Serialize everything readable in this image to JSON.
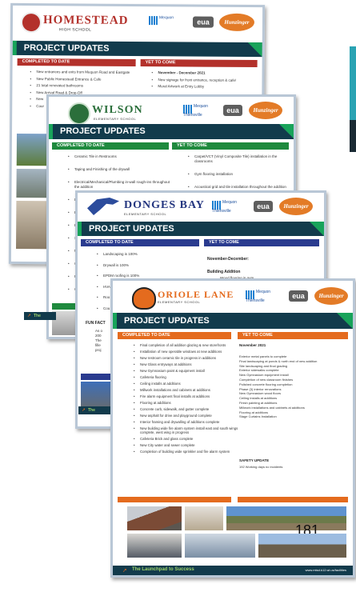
{
  "card1": {
    "school": "HOMESTEAD",
    "sub": "HIGH SCHOOL",
    "banner": "PROJECT UPDATES",
    "col_left": "COMPLETED TO DATE",
    "col_right": "YET TO COME",
    "left_items": [
      "New entrances and exits from Mequon Road and Eastgate",
      "New Public Homestead Entrance & Cafe",
      "21 total renovated bathrooms",
      "New Arrival Road & Drop-Off",
      "New",
      "Cour"
    ],
    "right_items": [
      "November - December 2021",
      "New signage for front entrance, reception & cafe!",
      "Mural Artwork at Entry Lobby"
    ]
  },
  "card2": {
    "school": "WILSON",
    "sub": "ELEMENTARY SCHOOL",
    "banner": "PROJECT UPDATES",
    "col_left": "COMPLETED TO DATE",
    "col_right": "YET TO COME",
    "left_items": [
      "Ceramic Tile in Restrooms",
      "Taping and Finishing of the drywall",
      "Electrical/Mechanical/Plumbing in-wall rough-ins throughout the addition",
      "Duc",
      "Ext",
      "Bric exte",
      "Spr roug",
      "Ma",
      "Cas",
      "Pai",
      "Cei"
    ],
    "right_items": [
      "Carpet/VCT (Vinyl Composite Tile) installation in the classrooms",
      "Gym flooring installation",
      "Acoustical grid and tile installation throughout the addition"
    ]
  },
  "card3": {
    "school": "DONGES BAY",
    "sub": "ELEMENTARY SCHOOL",
    "banner": "PROJECT UPDATES",
    "col_left": "COMPLETED TO DATE",
    "col_right": "YET TO COME",
    "left_items": [
      "Landscaping is 100%",
      "Drywall is 100%",
      "EPDM roofing is 100%",
      "HVA",
      "Roo",
      "Cou"
    ],
    "right_head": "November-December:",
    "right_sub": "Building Addition",
    "right_line": "Wood flooring in gym",
    "fun_facts": "FUN FACT",
    "fun_lines": [
      "As o",
      "200",
      "The",
      "fille",
      "proj"
    ]
  },
  "card4": {
    "school": "ORIOLE LANE",
    "sub": "ELEMENTARY SCHOOL",
    "banner": "PROJECT UPDATES",
    "col_left": "COMPLETED TO DATE",
    "col_right": "YET TO COME",
    "left_items": [
      "Final completion of all addition glazing & new storefronts",
      "Installation of new operable windows at new additions",
      "New restroom ceramic tile in progress in additions",
      "New Glass entryways at additions",
      "New Gymnasium paint & equipment install",
      "Cafeteria flooring",
      "Ceiling installs at additions",
      "Millwork installations and cabinets at additions",
      "Fire alarm equipment final installs at additions",
      "Flooring at additions",
      "Concrete curb, sidewalk, and gutter complete",
      "New asphalt for drive and playground complete",
      "Interior framing and drywalling of additions complete",
      "New building wide fire alarm system install east and south wings complete, west wing in progress",
      "Cafeteria Brick and glass complete",
      "New City water and sewer complete",
      "Completion of building wide sprinkler and fire alarm system"
    ],
    "right_head": "November 2021",
    "right_items": [
      "Exterior metal panels to complete",
      "Final landscaping at ponds & north end of new addition",
      "Site landscaping and final grading",
      "Exterior sidewalks complete",
      "New Gymnasium equipment install",
      "Completion of new classroom finishes",
      "Polished concrete flooring completion",
      "Phase (3) interior renovations",
      "New Gymnasium wood floors",
      "Ceiling installs at additions",
      "Finish painting at additions",
      "Millwork installations and cabinets at additions",
      "Flooring at additions",
      "Stage Curtains Installation"
    ],
    "safety_head": "SAFETY UPDATE",
    "safety_text": "192 Working days no incidents",
    "photo_number": "181",
    "footer_tag": "The Launchpad to Success",
    "footer_url": "www.mtsd.k12.wi.us/facilities"
  },
  "partner": {
    "mt1": "Mequon",
    "mt2": "Thiensville",
    "mt3": "SCHOOL DISTRICT",
    "eula": "eua",
    "hz": "Hunzinger"
  },
  "footer_small": "The",
  "colors": {
    "navy": "#123b4c",
    "green": "#18a35a",
    "red": "#b3312b",
    "orange": "#e46b1e",
    "blue": "#2a3b8f"
  }
}
